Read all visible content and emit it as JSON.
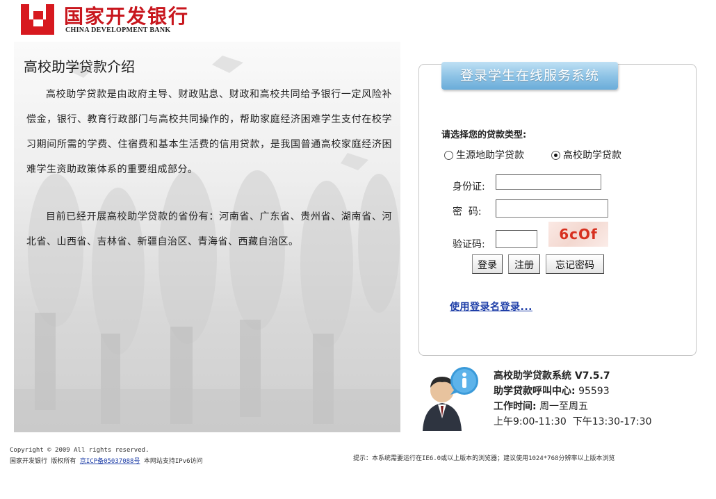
{
  "brand": {
    "name_cn": "国家开发银行",
    "name_en": "CHINA DEVELOPMENT BANK",
    "color": "#c8161d"
  },
  "intro": {
    "title": "高校助学贷款介绍",
    "paragraph1": "高校助学贷款是由政府主导、财政贴息、财政和高校共同给予银行一定风险补偿金，银行、教育行政部门与高校共同操作的，帮助家庭经济困难学生支付在校学习期间所需的学费、住宿费和基本生活费的信用贷款，是我国普通高校家庭经济困难学生资助政策体系的重要组成部分。",
    "paragraph2": "目前已经开展高校助学贷款的省份有：河南省、广东省、贵州省、湖南省、河北省、山西省、吉林省、新疆自治区、青海省、西藏自治区。"
  },
  "login": {
    "header": "登录学生在线服务系统",
    "loan_type_label": "请选择您的贷款类型:",
    "loan_types": [
      {
        "label": "生源地助学贷款",
        "selected": false
      },
      {
        "label": "高校助学贷款",
        "selected": true
      }
    ],
    "id_label": "身份证:",
    "id_value": "",
    "password_label": "密  码:",
    "password_value": "",
    "captcha_label": "验证码:",
    "captcha_value": "",
    "captcha_text": "6cOf",
    "buttons": {
      "login": "登录",
      "register": "注册",
      "forgot": "忘记密码"
    },
    "login_name_link": "使用登录名登录..."
  },
  "info": {
    "system_name": "高校助学贷款系统 V7.5.7",
    "hotline_label": "助学贷款呼叫中心:",
    "hotline": "95593",
    "hours_label": "工作时间:",
    "hours_days": "周一至周五",
    "hours_time": "上午9:00-11:30  下午13:30-17:30",
    "icon": "customer-service-info-icon"
  },
  "footer": {
    "copyright": "Copyright © 2009 All rights reserved.",
    "owner": "国家开发银行 版权所有",
    "icp": "京ICP备05037088号",
    "ipv6": "本网站支持IPv6访问",
    "tip": "提示：本系统需要运行在IE6.0或以上版本的浏览器；建议使用1024*768分辨率以上版本浏览"
  }
}
